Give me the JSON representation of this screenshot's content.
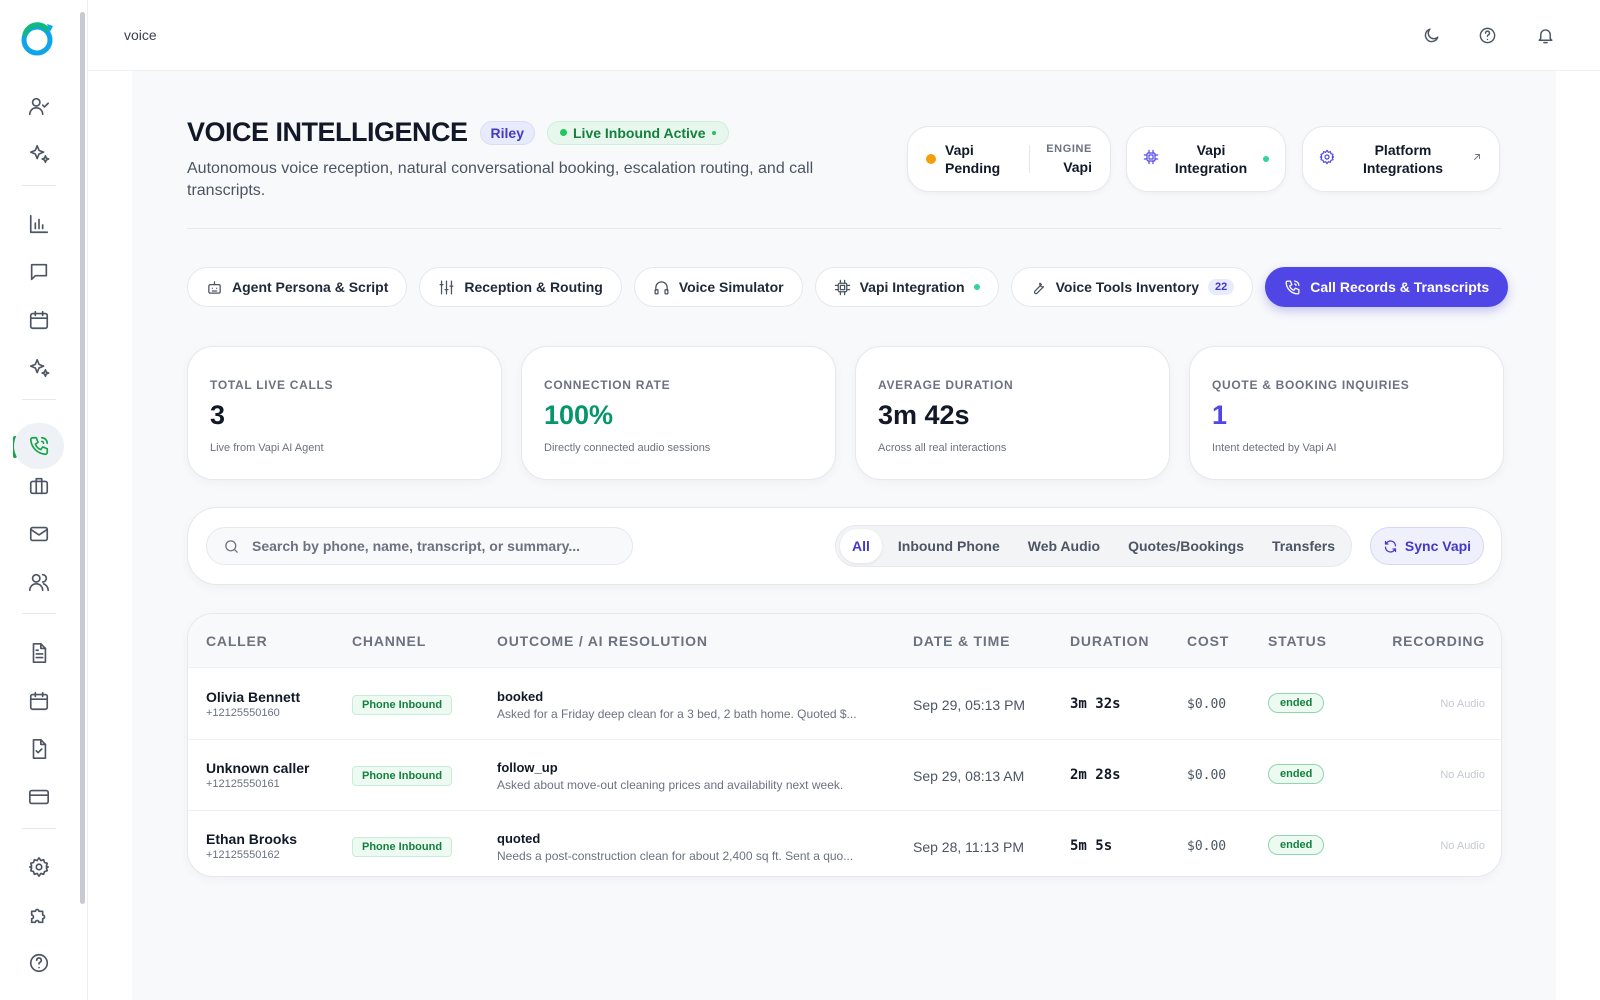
{
  "breadcrumb": "voice",
  "colors": {
    "accent": "#4f46e5",
    "success": "#16a34a",
    "pending": "#f59e0b"
  },
  "sidebar": {
    "icons": [
      "user-check-icon",
      "sparkles-icon",
      "bar-chart-icon",
      "message-icon",
      "calendar-icon",
      "sparkles-icon",
      "phone-call-icon",
      "briefcase-icon",
      "mail-icon",
      "users-icon",
      "file-text-icon",
      "calendar-icon",
      "file-check-icon",
      "credit-card-icon",
      "settings-icon",
      "puzzle-icon",
      "help-circle-icon"
    ],
    "active": "phone-call-icon"
  },
  "topbar": {
    "icons": [
      "moon-icon",
      "help-circle-icon",
      "bell-icon"
    ]
  },
  "header": {
    "title": "VOICE INTELLIGENCE",
    "persona_badge": "Riley",
    "status_badge": "Live Inbound Active",
    "subtitle": "Autonomous voice reception, natural conversational booking, escalation routing, and call transcripts."
  },
  "status_cards": {
    "vapi_status_line1": "Vapi",
    "vapi_status_line2": "Pending",
    "engine_label": "ENGINE",
    "engine_value": "Vapi",
    "integration_line1": "Vapi",
    "integration_line2": "Integration",
    "platform_line1": "Platform",
    "platform_line2": "Integrations"
  },
  "tabs": [
    {
      "label": "Agent Persona & Script",
      "icon": "bot-icon"
    },
    {
      "label": "Reception & Routing",
      "icon": "sliders-icon"
    },
    {
      "label": "Voice Simulator",
      "icon": "headphones-icon"
    },
    {
      "label": "Vapi Integration",
      "icon": "chip-icon"
    },
    {
      "label": "Voice Tools Inventory",
      "icon": "wrench-icon",
      "count": "22"
    },
    {
      "label": "Call Records & Transcripts",
      "icon": "phone-call-icon",
      "active": true
    }
  ],
  "stats": [
    {
      "label": "TOTAL LIVE CALLS",
      "value": "3",
      "hint": "Live from Vapi AI Agent",
      "color": "#111827"
    },
    {
      "label": "CONNECTION RATE",
      "value": "100%",
      "hint": "Directly connected audio sessions",
      "color": "#059669"
    },
    {
      "label": "AVERAGE DURATION",
      "value": "3m 42s",
      "hint": "Across all real interactions",
      "color": "#111827"
    },
    {
      "label": "QUOTE & BOOKING INQUIRIES",
      "value": "1",
      "hint": "Intent detected by Vapi AI",
      "color": "#4f46e5"
    }
  ],
  "filters": {
    "search_placeholder": "Search by phone, name, transcript, or summary...",
    "options": [
      "All",
      "Inbound Phone",
      "Web Audio",
      "Quotes/Bookings",
      "Transfers"
    ],
    "selected": "All",
    "sync_label": "Sync Vapi"
  },
  "table": {
    "columns": [
      "CALLER",
      "CHANNEL",
      "OUTCOME / AI RESOLUTION",
      "DATE & TIME",
      "DURATION",
      "COST",
      "STATUS",
      "RECORDING"
    ],
    "rows": [
      {
        "name": "Olivia Bennett",
        "phone": "+12125550160",
        "channel": "Phone Inbound",
        "outcome": "booked",
        "summary": "Asked for a Friday deep clean for a 3 bed, 2 bath home. Quoted $...",
        "datetime": "Sep 29, 05:13 PM",
        "duration": "3m 32s",
        "cost": "$0.00",
        "status": "ended",
        "recording": "No Audio"
      },
      {
        "name": "Unknown caller",
        "phone": "+12125550161",
        "channel": "Phone Inbound",
        "outcome": "follow_up",
        "summary": "Asked about move-out cleaning prices and availability next week.",
        "datetime": "Sep 29, 08:13 AM",
        "duration": "2m 28s",
        "cost": "$0.00",
        "status": "ended",
        "recording": "No Audio"
      },
      {
        "name": "Ethan Brooks",
        "phone": "+12125550162",
        "channel": "Phone Inbound",
        "outcome": "quoted",
        "summary": "Needs a post-construction clean for about 2,400 sq ft. Sent a quo...",
        "datetime": "Sep 28, 11:13 PM",
        "duration": "5m 5s",
        "cost": "$0.00",
        "status": "ended",
        "recording": "No Audio"
      }
    ]
  }
}
